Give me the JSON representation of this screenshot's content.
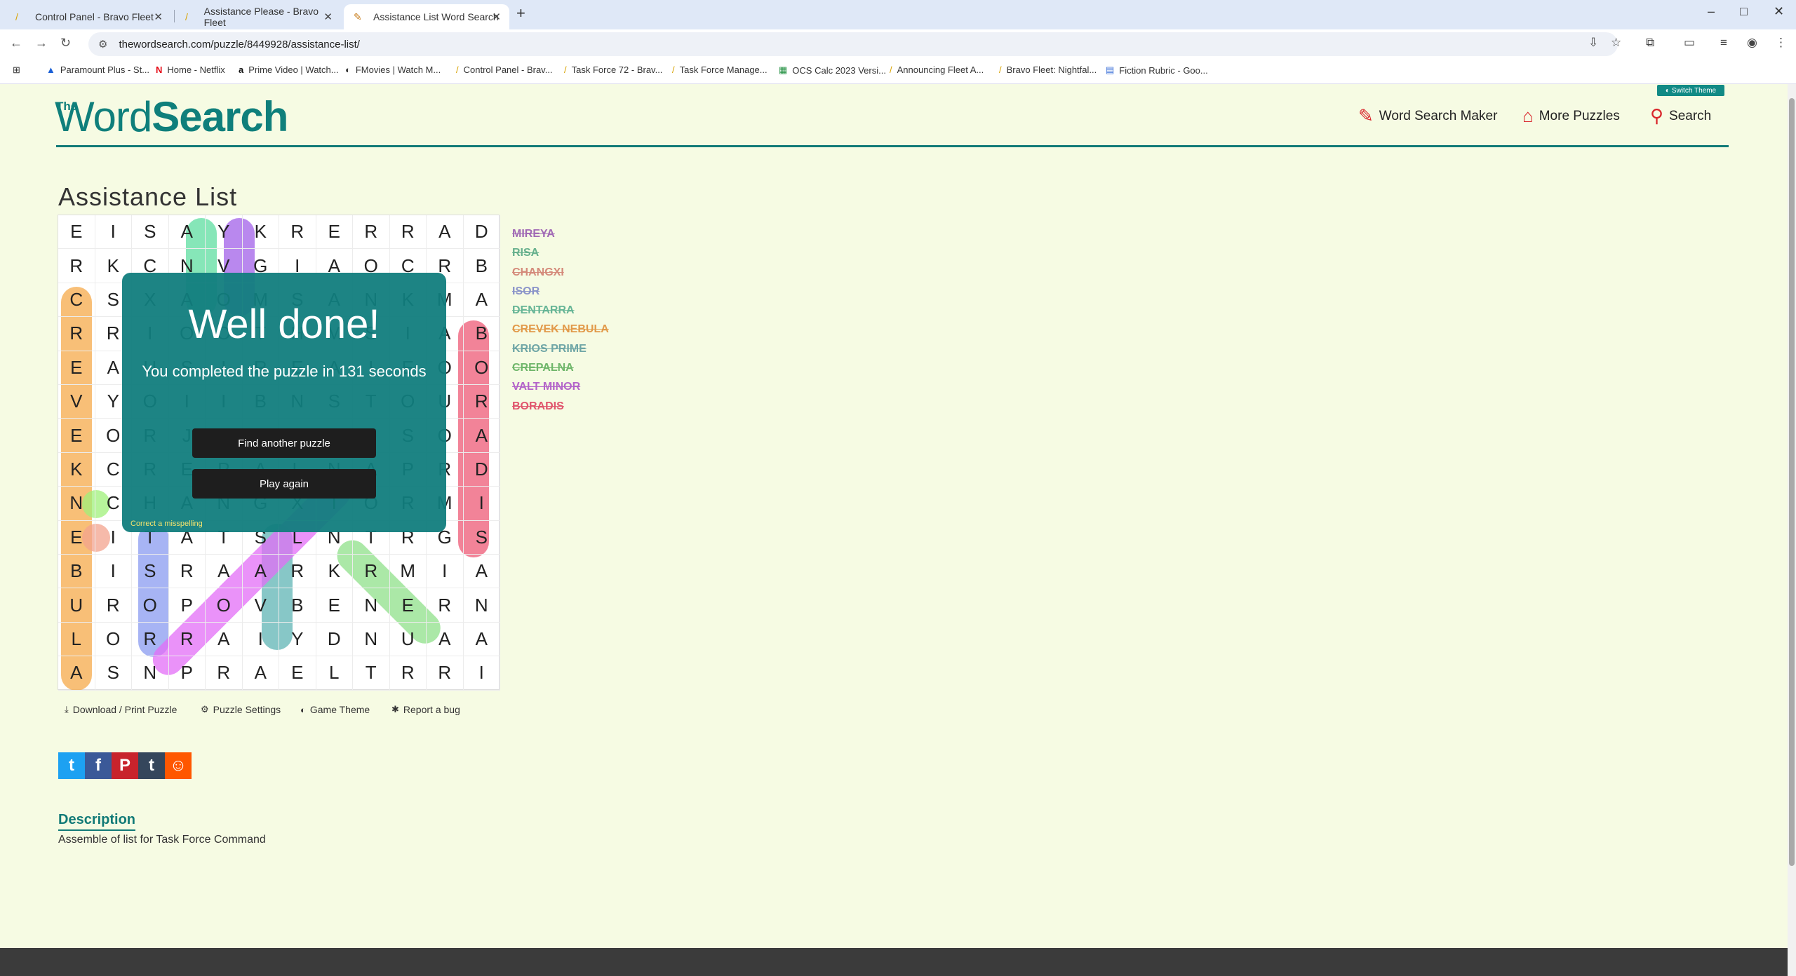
{
  "browser": {
    "tabs": [
      {
        "title": "Control Panel - Bravo Fleet"
      },
      {
        "title": "Assistance Please - Bravo Fleet"
      },
      {
        "title": "Assistance List Word Search"
      }
    ],
    "url": "thewordsearch.com/puzzle/8449928/assistance-list/",
    "bookmarks": [
      {
        "label": "Paramount Plus - St..."
      },
      {
        "label": "Home - Netflix"
      },
      {
        "label": "Prime Video | Watch..."
      },
      {
        "label": "FMovies | Watch M..."
      },
      {
        "label": "Control Panel - Brav..."
      },
      {
        "label": "Task Force 72 - Brav..."
      },
      {
        "label": "Task Force Manage..."
      },
      {
        "label": "OCS Calc 2023 Versi..."
      },
      {
        "label": "Announcing Fleet A..."
      },
      {
        "label": "Bravo Fleet: Nightfal..."
      },
      {
        "label": "Fiction Rubric - Goo..."
      }
    ]
  },
  "header": {
    "switch_theme": "Switch Theme",
    "logo_the": "The",
    "logo_word": "Word",
    "logo_search": "Search",
    "nav": [
      {
        "label": "Word Search Maker"
      },
      {
        "label": "More Puzzles"
      },
      {
        "label": "Search"
      }
    ]
  },
  "puzzle": {
    "title": "Assistance List",
    "grid": [
      "EISAYKRERRAD",
      "RKCNVGIAOCRB",
      "CSXAOMSANKMA",
      "RRIOOTHMSIAB",
      "EAUSIREAIEOO",
      "VYOIIBNSTOUR",
      "EORJUNTOUSOA",
      "KCREPALNAPRD",
      "NCHANGXIORMI",
      "EITATSLNTRGS",
      "BISRAARKRMIA",
      "UROPOVBENERN",
      "LORRAIYDNUAA",
      "ASNPRAELTRRI"
    ],
    "words": [
      {
        "text": "MIREYA",
        "color": "#a16ab5"
      },
      {
        "text": "RISA",
        "color": "#67b08d"
      },
      {
        "text": "CHANGXI",
        "color": "#d48a7a"
      },
      {
        "text": "ISOR",
        "color": "#8a94c9"
      },
      {
        "text": "DENTARRA",
        "color": "#66b596"
      },
      {
        "text": "CREVEK NEBULA",
        "color": "#e29a4a"
      },
      {
        "text": "KRIOS PRIME",
        "color": "#6fa6a6"
      },
      {
        "text": "CREPALNA",
        "color": "#6fb66a"
      },
      {
        "text": "VALT MINOR",
        "color": "#b364c9"
      },
      {
        "text": "BORADIS",
        "color": "#e0566d"
      }
    ],
    "completion": {
      "title": "Well done!",
      "message": "You completed the puzzle in 131 seconds",
      "find_another": "Find another puzzle",
      "play_again": "Play again",
      "correct_misspelling": "Correct a misspelling"
    },
    "actions": [
      {
        "label": "Download / Print Puzzle"
      },
      {
        "label": "Puzzle Settings"
      },
      {
        "label": "Game Theme"
      },
      {
        "label": "Report a bug"
      }
    ]
  },
  "social": [
    {
      "icon": "twitter-icon",
      "glyph": "t",
      "color": "#1da1f2"
    },
    {
      "icon": "facebook-icon",
      "glyph": "f",
      "color": "#3b5998"
    },
    {
      "icon": "pinterest-icon",
      "glyph": "P",
      "color": "#c8232c"
    },
    {
      "icon": "tumblr-icon",
      "glyph": "t",
      "color": "#35465c"
    },
    {
      "icon": "reddit-icon",
      "glyph": "☺",
      "color": "#ff5700"
    }
  ],
  "description": {
    "heading": "Description",
    "text": "Assemble of list for Task Force Command"
  }
}
